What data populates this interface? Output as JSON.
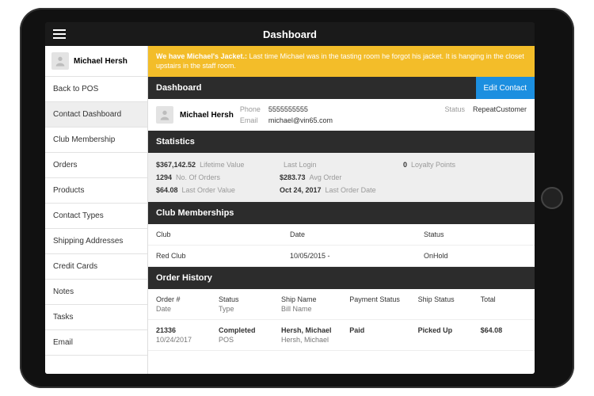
{
  "topbar": {
    "title": "Dashboard"
  },
  "sidebar": {
    "contact_name": "Michael Hersh",
    "items": [
      {
        "label": "Back to POS"
      },
      {
        "label": "Contact Dashboard",
        "active": true
      },
      {
        "label": "Club Membership"
      },
      {
        "label": "Orders"
      },
      {
        "label": "Products"
      },
      {
        "label": "Contact Types"
      },
      {
        "label": "Shipping Addresses"
      },
      {
        "label": "Credit Cards"
      },
      {
        "label": "Notes"
      },
      {
        "label": "Tasks"
      },
      {
        "label": "Email"
      }
    ]
  },
  "alert": {
    "title": "We have Michael's Jacket.:",
    "body": "Last time Michael was in the tasting room he forgot his jacket. It is hanging in the closet upstairs in the staff room."
  },
  "dashboard": {
    "title": "Dashboard",
    "edit_label": "Edit Contact",
    "name": "Michael Hersh",
    "phone_label": "Phone",
    "phone": "5555555555",
    "email_label": "Email",
    "email": "michael@vin65.com",
    "status_label": "Status",
    "status": "RepeatCustomer"
  },
  "stats": {
    "title": "Statistics",
    "lifetime_value": "$367,142.52",
    "lifetime_value_label": "Lifetime Value",
    "last_login": "",
    "last_login_label": "Last Login",
    "loyalty": "0",
    "loyalty_label": "Loyalty Points",
    "orders": "1294",
    "orders_label": "No. Of Orders",
    "avg_order": "$283.73",
    "avg_order_label": "Avg Order",
    "last_order_value": "$64.08",
    "last_order_value_label": "Last Order Value",
    "last_order_date": "Oct 24, 2017",
    "last_order_date_label": "Last Order Date"
  },
  "clubs": {
    "title": "Club Memberships",
    "cols": {
      "club": "Club",
      "date": "Date",
      "status": "Status"
    },
    "rows": [
      {
        "club": "Red Club",
        "date": "10/05/2015 -",
        "status": "OnHold"
      }
    ]
  },
  "orders": {
    "title": "Order History",
    "cols": {
      "order": "Order #",
      "date": "Date",
      "status": "Status",
      "type": "Type",
      "ship": "Ship Name",
      "bill": "Bill Name",
      "pay": "Payment Status",
      "shipstat": "Ship Status",
      "total": "Total"
    },
    "rows": [
      {
        "order": "21336",
        "date": "10/24/2017",
        "status": "Completed",
        "type": "POS",
        "ship": "Hersh, Michael",
        "bill": "Hersh, Michael",
        "pay": "Paid",
        "shipstat": "Picked Up",
        "total": "$64.08"
      }
    ]
  }
}
